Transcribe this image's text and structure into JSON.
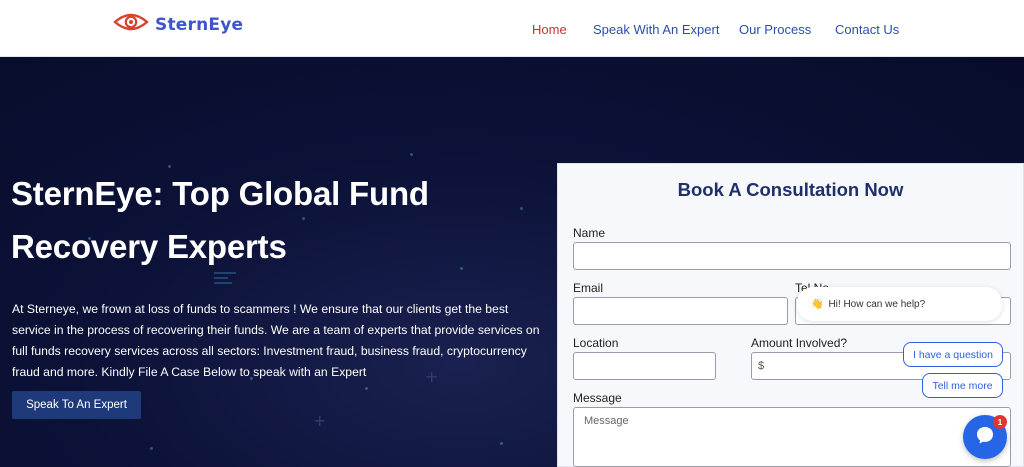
{
  "brand": {
    "name": "SternEye"
  },
  "nav": {
    "items": [
      {
        "label": "Home",
        "active": true
      },
      {
        "label": "Speak With An Expert",
        "active": false
      },
      {
        "label": "Our Process",
        "active": false
      },
      {
        "label": "Contact Us",
        "active": false
      }
    ]
  },
  "hero": {
    "title_line1": "SternEye: Top Global Fund",
    "title_line2": "Recovery Experts",
    "description": "At Sterneye, we frown at loss of funds to scammers ! We ensure that our clients get the best service in the process of recovering their funds. We are a team of experts that provide services on full funds recovery services across all sectors: Investment fraud, business fraud, cryptocurrency fraud and more. Kindly File A Case Below to speak with an Expert",
    "cta_label": "Speak To An Expert"
  },
  "form": {
    "title": "Book A Consultation Now",
    "name_label": "Name",
    "email_label": "Email",
    "tel_label": "Tel No",
    "location_label": "Location",
    "amount_label": "Amount Involved?",
    "amount_prefix": "$",
    "message_label": "Message",
    "message_placeholder": "Message"
  },
  "chat": {
    "greeting": "Hi! How can we help?",
    "greeting_emoji": "👋",
    "option1": "I have a question",
    "option2": "Tell me more",
    "badge_count": "1"
  },
  "colors": {
    "brand_blue": "#3d56c9",
    "nav_active": "#c93030",
    "hero_bg": "#0c1238",
    "cta_bg": "#1f3a7a",
    "form_title": "#1e2f6b",
    "chat_blue": "#2565e6"
  }
}
